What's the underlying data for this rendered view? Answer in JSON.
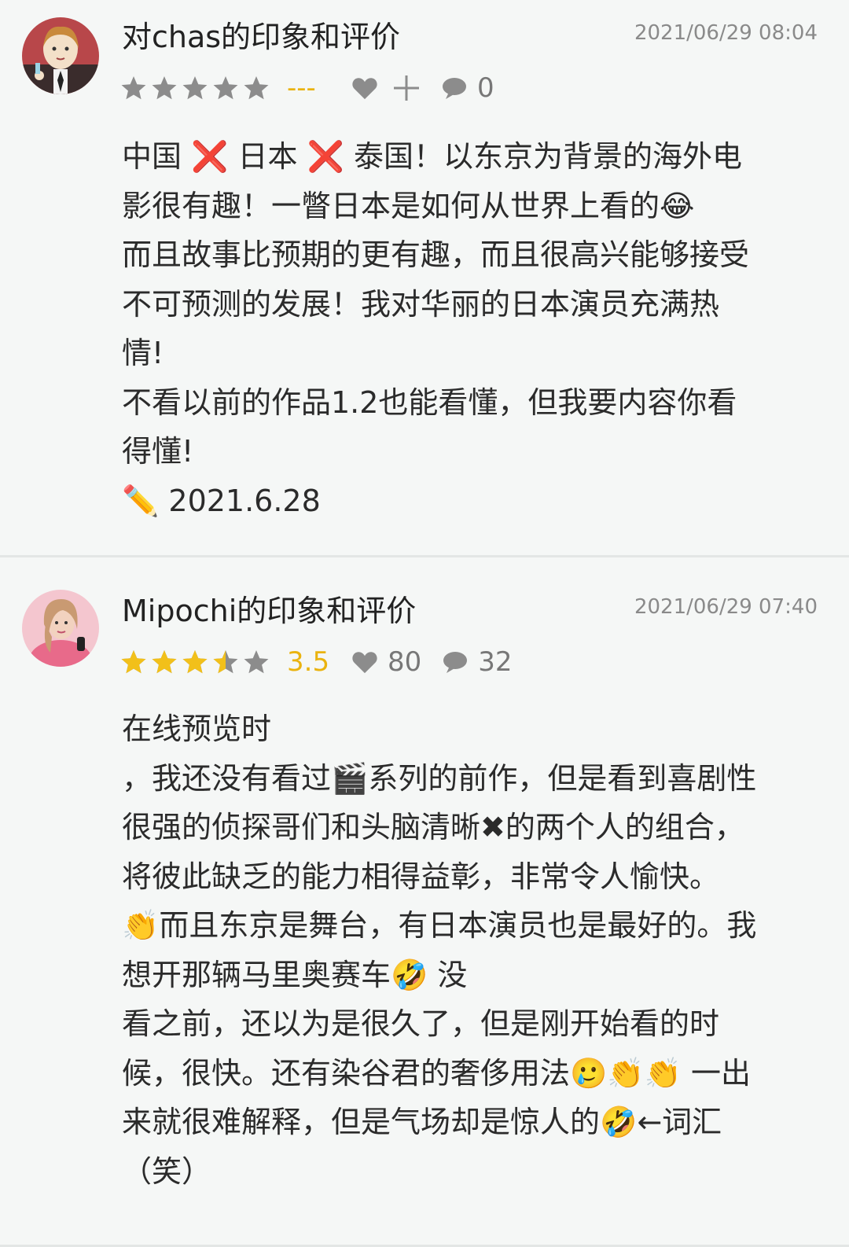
{
  "colors": {
    "background": "#f5f7f6",
    "star_gold": "#f2c01a",
    "star_gray": "#8c8c8c",
    "score_gold": "#eab30f",
    "meta_gray": "#777777",
    "divider": "#e3e6e5"
  },
  "reviews": [
    {
      "title": "对chas的印象和评价",
      "timestamp": "2021/06/29 08:04",
      "rating": 0,
      "score": "---",
      "likes": "",
      "comments": "0",
      "icons": [
        "star-icon",
        "heart-icon",
        "plus-icon",
        "comment-icon"
      ],
      "body": [
        "中国 ❌ 日本 ❌ 泰国！以东京为背景的海外电",
        "影很有趣！一瞥日本是如何从世界上看的😂",
        "而且故事比预期的更有趣，而且很高兴能够接受",
        "不可预测的发展！我对华丽的日本演员充满热",
        "情!",
        "不看以前的作品1.2也能看懂，但我要内容你看",
        "得懂!",
        "✏️ 2021.6.28"
      ]
    },
    {
      "title": "Mipochi的印象和评价",
      "timestamp": "2021/06/29 07:40",
      "rating": 3.5,
      "score": "3.5",
      "likes": "80",
      "comments": "32",
      "icons": [
        "star-icon",
        "heart-icon",
        "comment-icon"
      ],
      "body": [
        "在线预览时",
        "，我还没有看过🎬系列的前作，但是看到喜剧性",
        "很强的侦探哥们和头脑清晰✖的两个人的组合，",
        "将彼此缺乏的能力相得益彰，非常令人愉快。",
        "👏而且东京是舞台，有日本演员也是最好的。我",
        "想开那辆马里奥赛车🤣 没",
        "看之前，还以为是很久了，但是刚开始看的时",
        "候，很快。还有染谷君的奢侈用法🥲👏👏 一出",
        "来就很难解释，但是气场却是惊人的🤣←词汇",
        "（笑）"
      ]
    }
  ]
}
